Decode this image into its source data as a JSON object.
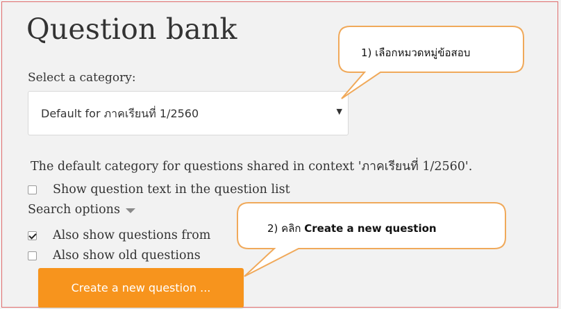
{
  "page": {
    "title": "Question bank",
    "select_label": "Select a category:",
    "category_select": {
      "selected": "Default for ภาคเรียนที่ 1/2560"
    },
    "default_category_text": "The default category for questions shared in context 'ภาคเรียนที่ 1/2560'.",
    "options": {
      "show_question_text": {
        "label": "Show question text in the question list",
        "checked": false
      },
      "search_options_label": "Search options",
      "also_show_subcategories": {
        "label": "Also show questions from",
        "checked": true
      },
      "also_show_old": {
        "label": "Also show old questions",
        "checked": false
      }
    },
    "create_button_label": "Create a new question ..."
  },
  "callouts": {
    "step1": "1)  เลือกหมวดหมู่ข้อสอบ",
    "step2_prefix": "2)  คลิก ",
    "step2_bold": "Create a new question",
    "border_color": "#f0a95a"
  },
  "colors": {
    "accent_button": "#f7941d",
    "frame_border": "#e06b6b",
    "background": "#f2f2f2"
  }
}
